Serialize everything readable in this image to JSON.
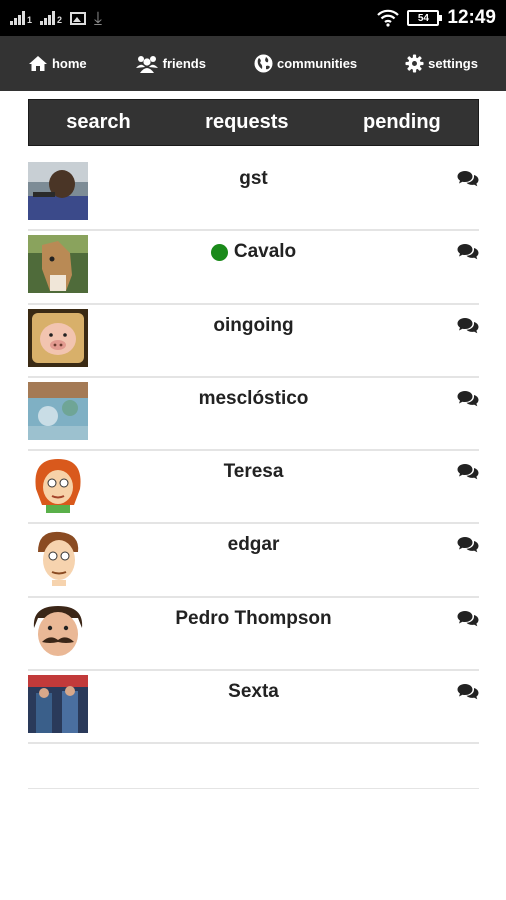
{
  "status_bar": {
    "signal_label_1": "1",
    "signal_label_2": "2",
    "battery": "54",
    "time": "12:49"
  },
  "nav": {
    "home": "home",
    "friends": "friends",
    "communities": "communities",
    "settings": "settings"
  },
  "tabs": {
    "search": "search",
    "requests": "requests",
    "pending": "pending"
  },
  "contacts": [
    {
      "name": "gst",
      "online": false
    },
    {
      "name": "Cavalo",
      "online": true
    },
    {
      "name": "oingoing",
      "online": false
    },
    {
      "name": "mesclóstico",
      "online": false
    },
    {
      "name": "Teresa",
      "online": false
    },
    {
      "name": "edgar",
      "online": false
    },
    {
      "name": "Pedro Thompson",
      "online": false
    },
    {
      "name": "Sexta",
      "online": false
    }
  ],
  "colors": {
    "nav_bg": "#333333",
    "online": "#1a8a1a"
  }
}
